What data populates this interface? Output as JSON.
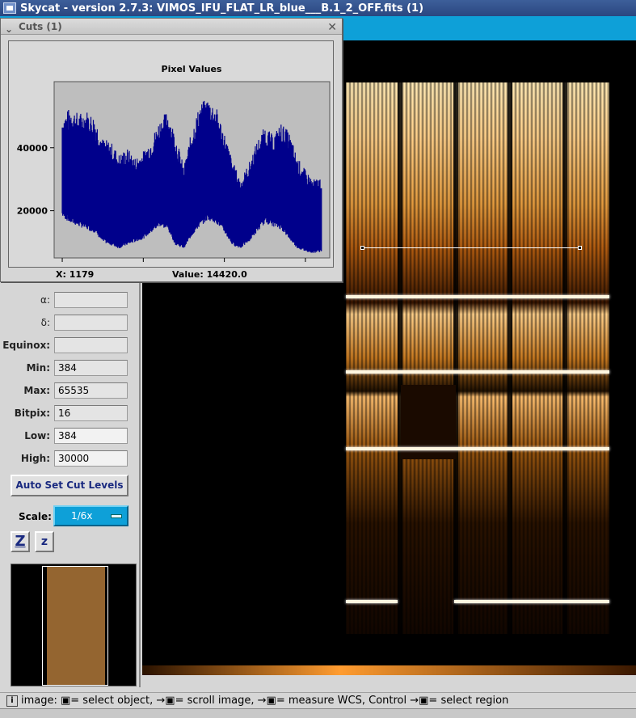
{
  "window": {
    "title": "Skycat - version 2.7.3: VIMOS_IFU_FLAT_LR_blue___B.1_2_OFF.fits (1)"
  },
  "cuts_window": {
    "title": "Cuts (1)",
    "close_glyph": "✕",
    "x_readout": "X: 1179",
    "value_readout": "Value: 14420.0"
  },
  "chart_data": {
    "type": "line",
    "title": "Pixel Values",
    "xlabel": "",
    "ylabel": "",
    "xlim": [
      -50,
      1650
    ],
    "ylim": [
      5000,
      61000
    ],
    "x_ticks": [
      0,
      500,
      1000,
      1500
    ],
    "y_ticks": [
      20000,
      40000
    ],
    "series": [
      {
        "color": "#00008b",
        "envelope_x": [
          0,
          50,
          100,
          150,
          200,
          250,
          300,
          350,
          400,
          450,
          500,
          550,
          600,
          650,
          700,
          750,
          800,
          850,
          900,
          950,
          1000,
          1050,
          1100,
          1150,
          1200,
          1250,
          1300,
          1350,
          1400,
          1450,
          1500,
          1550,
          1600
        ],
        "upper": [
          50000,
          53000,
          51000,
          52000,
          50000,
          43000,
          42000,
          38000,
          40000,
          37000,
          39000,
          43000,
          49000,
          52000,
          44000,
          34000,
          46000,
          54000,
          56000,
          53000,
          45000,
          36000,
          30000,
          35000,
          42000,
          47000,
          44000,
          48000,
          45000,
          37000,
          33000,
          30000,
          31000
        ],
        "lower": [
          18000,
          16000,
          15000,
          14000,
          13000,
          10000,
          9000,
          8000,
          9000,
          10000,
          11000,
          13000,
          15000,
          14000,
          9000,
          8000,
          12000,
          15000,
          17000,
          16000,
          13000,
          9000,
          8000,
          10000,
          13000,
          16000,
          15000,
          14000,
          11000,
          8000,
          7000,
          6500,
          7000
        ]
      }
    ]
  },
  "fields": [
    {
      "label": "α:",
      "value": ""
    },
    {
      "label": "δ:",
      "value": ""
    },
    {
      "label": "Equinox:",
      "value": ""
    },
    {
      "label": "Min:",
      "value": "384"
    },
    {
      "label": "Max:",
      "value": "65535"
    },
    {
      "label": "Bitpix:",
      "value": "16"
    },
    {
      "label": "Low:",
      "value": "384"
    },
    {
      "label": "High:",
      "value": "30000"
    }
  ],
  "controls": {
    "auto_cut_label": "Auto Set Cut Levels",
    "scale_label": "Scale:",
    "scale_value": "1/6x",
    "zoom_in_label": "Z",
    "zoom_out_label": "z"
  },
  "statusbar": {
    "icon": "i",
    "text": "image: ▣= select object, →▣= scroll image, →▣= measure WCS, Control →▣= select region"
  },
  "colors": {
    "accent": "#0ea0d8",
    "plot_line": "#00008b",
    "title_bar": "#2a4680"
  }
}
